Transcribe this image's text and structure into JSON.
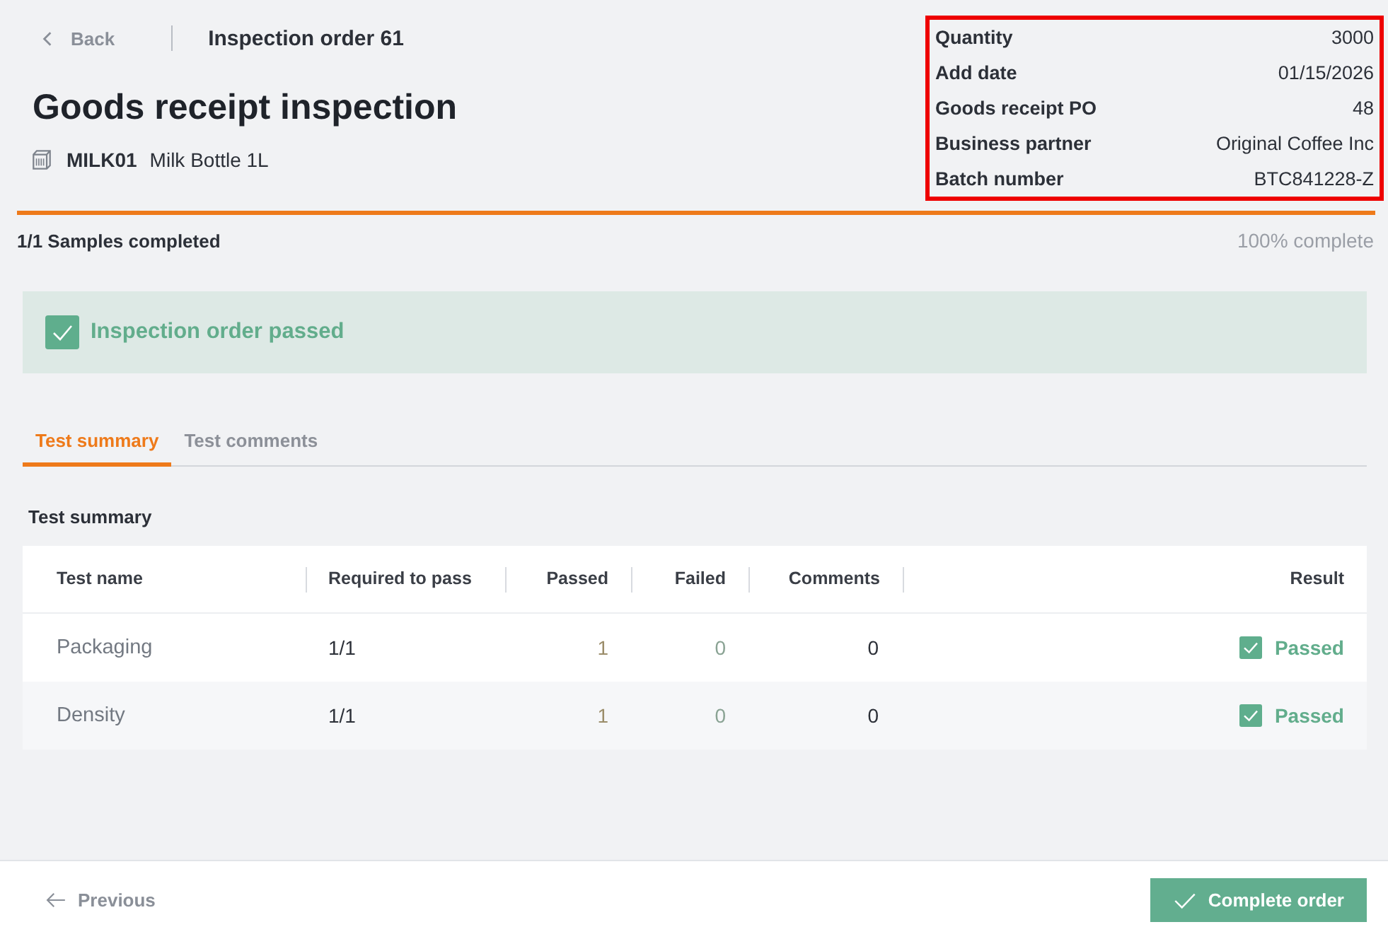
{
  "header": {
    "back_label": "Back",
    "order_title": "Inspection order 61"
  },
  "title": "Goods receipt inspection",
  "item": {
    "code": "MILK01",
    "name": "Milk Bottle 1L"
  },
  "details": {
    "highlighted": true,
    "rows": [
      {
        "label": "Quantity",
        "value": "3000"
      },
      {
        "label": "Add date",
        "value": "01/15/2026"
      },
      {
        "label": "Goods receipt PO",
        "value": "48"
      },
      {
        "label": "Business partner",
        "value": "Original Coffee Inc"
      },
      {
        "label": "Batch number",
        "value": "BTC841228-Z"
      }
    ]
  },
  "progress": {
    "level": 1,
    "label": "1/1 Samples completed",
    "percent_label": "100% complete"
  },
  "status_banner": {
    "kind": "success",
    "text": "Inspection order passed"
  },
  "tabs": [
    {
      "label": "Test summary",
      "selected": true
    },
    {
      "label": "Test comments",
      "selected": false
    }
  ],
  "section_title": "Test summary",
  "table": {
    "columns": [
      "Test name",
      "Required to pass",
      "Passed",
      "Failed",
      "Comments",
      "Result"
    ],
    "rows": [
      {
        "test_name": "Packaging",
        "required_to_pass": "1/1",
        "passed": "1",
        "failed": "0",
        "comments": "0",
        "result": {
          "kind": "passed",
          "label": "Passed"
        }
      },
      {
        "test_name": "Density",
        "required_to_pass": "1/1",
        "passed": "1",
        "failed": "0",
        "comments": "0",
        "result": {
          "kind": "passed",
          "label": "Passed"
        }
      }
    ]
  },
  "footer": {
    "previous_label": "Previous",
    "primary_button": "Complete order"
  }
}
